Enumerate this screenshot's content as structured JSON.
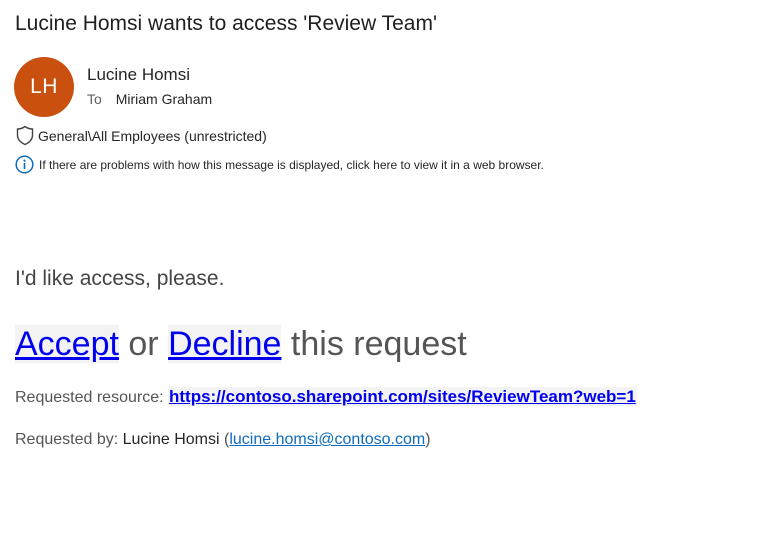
{
  "email": {
    "subject": "Lucine Homsi wants to access 'Review Team'",
    "sender": {
      "initials": "LH",
      "name": "Lucine Homsi",
      "avatar_color": "#ca5010"
    },
    "to_label": "To",
    "recipient": "Miriam Graham",
    "sensitivity_label": "General\\All Employees (unrestricted)",
    "info_message": "If there are problems with how this message is displayed, click here to view it in a web browser."
  },
  "body": {
    "message": "I'd like access, please.",
    "accept_label": "Accept",
    "or_text": " or ",
    "decline_label": "Decline",
    "request_suffix": " this request",
    "resource_label": "Requested resource: ",
    "resource_url": "https://contoso.sharepoint.com/sites/ReviewTeam?web=1",
    "requested_by_label": "Requested by: ",
    "requester_name": "Lucine Homsi",
    "open_paren": " (",
    "requester_email": "lucine.homsi@contoso.com",
    "close_paren": ")"
  },
  "colors": {
    "link": "#0000ee",
    "email_link": "#0f6cbd",
    "info_icon": "#0f6cbd"
  }
}
